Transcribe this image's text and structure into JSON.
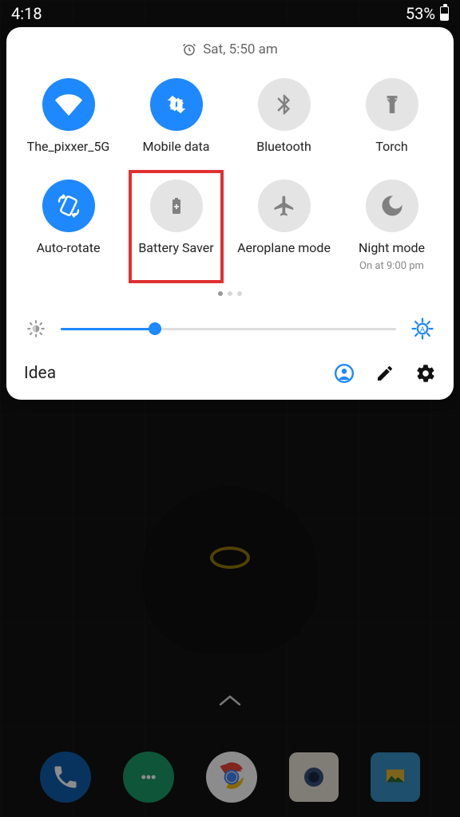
{
  "status": {
    "time": "4:18",
    "battery_pct": "53%"
  },
  "alarm": {
    "text": "Sat, 5:50 am"
  },
  "tiles": [
    {
      "label": "The_pixxer_5G",
      "state": "on",
      "icon": "wifi"
    },
    {
      "label": "Mobile data",
      "state": "on",
      "icon": "data"
    },
    {
      "label": "Bluetooth",
      "state": "off",
      "icon": "bluetooth"
    },
    {
      "label": "Torch",
      "state": "off",
      "icon": "torch"
    },
    {
      "label": "Auto-rotate",
      "state": "on",
      "icon": "rotate"
    },
    {
      "label": "Battery Saver",
      "state": "off",
      "icon": "battery-saver",
      "highlight": true
    },
    {
      "label": "Aeroplane mode",
      "state": "off",
      "icon": "airplane"
    },
    {
      "label": "Night mode",
      "state": "off",
      "icon": "moon",
      "sublabel": "On at 9:00 pm"
    }
  ],
  "pager": {
    "count": 3,
    "active": 0
  },
  "brightness": {
    "value_pct": 28
  },
  "footer": {
    "carrier": "Idea"
  },
  "colors": {
    "accent": "#1e88ff",
    "off_tile": "#e4e4e4",
    "highlight": "#e03131"
  }
}
